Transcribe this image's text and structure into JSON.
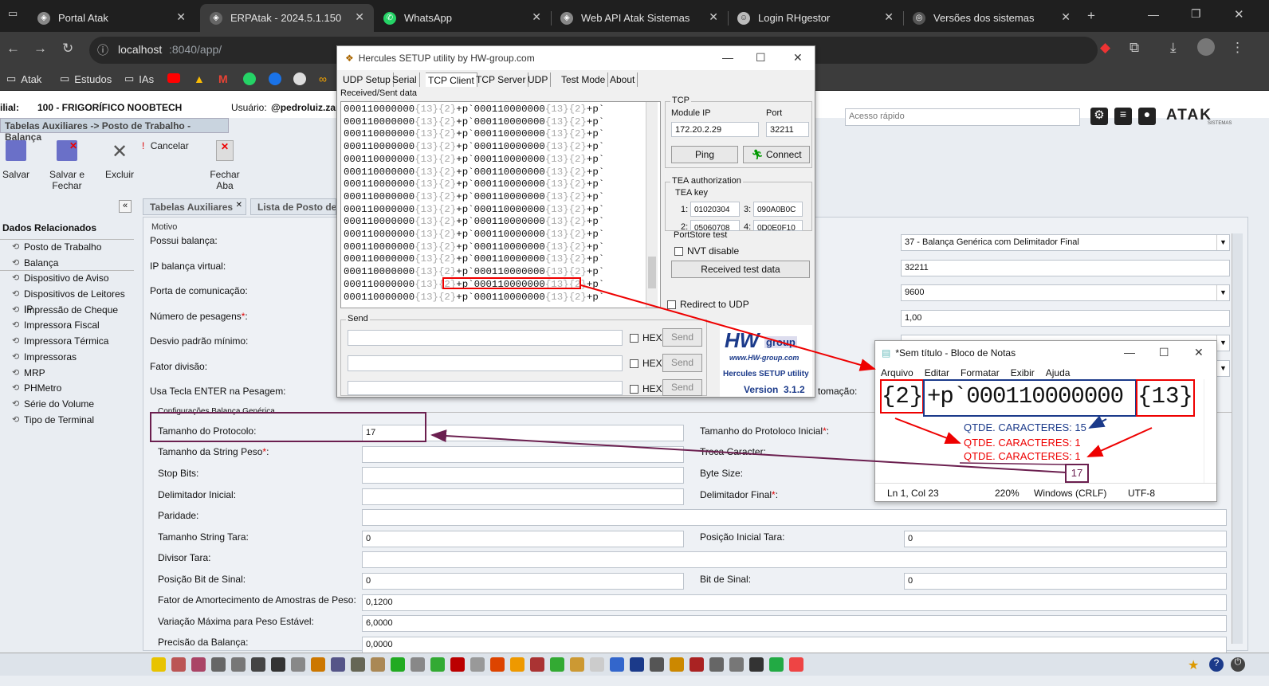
{
  "browser": {
    "tabs": [
      {
        "title": "Portal Atak"
      },
      {
        "title": "ERPAtak - 2024.5.1.150"
      },
      {
        "title": "WhatsApp"
      },
      {
        "title": "Web API Atak Sistemas"
      },
      {
        "title": "Login RHgestor"
      },
      {
        "title": "Versões dos sistemas"
      }
    ],
    "url_host": "localhost",
    "url_rest": ":8040/app/",
    "bookmarks": [
      "Atak",
      "Estudos",
      "IAs"
    ]
  },
  "erp": {
    "filial_label": "ilial:",
    "filial_value": "100 - FRIGORÍFICO NOOBTECH",
    "usuario_label": "Usuário:",
    "usuario_value": "@pedroluiz.zan",
    "quick_access_placeholder": "Acesso rápido",
    "logo": "ATAK",
    "logo_sub": "SISTEMAS",
    "breadcrumb": "Tabelas Auxiliares -> Posto de Trabalho - Balança",
    "toolbar": {
      "save": "Salvar",
      "save_close": "Salvar e Fechar",
      "delete": "Excluir",
      "cancel": "Cancelar",
      "close_tab": "Fechar Aba"
    },
    "tabs": [
      "Tabelas Auxiliares",
      "Lista de Posto de T"
    ],
    "sidebar": {
      "title": "Dados Relacionados",
      "items": [
        "Posto de Trabalho",
        "Balança",
        "Dispositivo de Aviso",
        "Dispositivos de Leitores IP",
        "Impressão de Cheque",
        "Impressora Fiscal",
        "Impressora Térmica",
        "Impressoras",
        "MRP",
        "PHMetro",
        "Série do Volume",
        "Tipo de Terminal"
      ]
    },
    "form": {
      "motivo_legend": "Motivo",
      "possui_balanca": "Possui balança:",
      "ip_balanca": "IP balança virtual:",
      "porta": "Porta de comunicação:",
      "num_pesagens": "Número de pesagens",
      "desvio": "Desvio padrão mínimo:",
      "fator_divisao": "Fator divisão:",
      "tecla_enter": "Usa Tecla ENTER na Pesagem:",
      "automacao_partial": "tomação:",
      "balanca_value": "37 - Balança Genérica com Delimitador Final",
      "ip_value": "32211",
      "porta_value": "9600",
      "num_value": "1,00",
      "config_legend": "Configurações Balança Genérica",
      "tam_protocolo": "Tamanho do Protocolo:",
      "tam_protocolo_value": "17",
      "tam_string_peso": "Tamanho da String Peso",
      "stop_bits": "Stop Bits:",
      "delim_inicial": "Delimitador Inicial:",
      "paridade": "Paridade:",
      "tam_string_tara": "Tamanho String Tara:",
      "tam_string_tara_value": "0",
      "divisor_tara": "Divisor Tara:",
      "pos_bit_sinal": "Posição Bit de Sinal:",
      "pos_bit_sinal_value": "0",
      "fator_amort": "Fator de Amortecimento de Amostras de Peso:",
      "fator_amort_value": "0,1200",
      "variacao": "Variação Máxima para Peso Estável:",
      "variacao_value": "6,0000",
      "precisao": "Precisão da Balança:",
      "precisao_value": "0,0000",
      "tam_prot_inicial": "Tamanho do Protoloco Inicial",
      "troca_caracter": "Troca Caracter:",
      "byte_size": "Byte Size:",
      "delim_final": "Delimitador Final",
      "pos_inicial_tara": "Posição Inicial Tara:",
      "pos_inicial_tara_value": "0",
      "bit_sinal": "Bit de Sinal:",
      "bit_sinal_value": "0"
    }
  },
  "hercules": {
    "title": "Hercules SETUP utility by HW-group.com",
    "tabs": [
      "UDP Setup",
      "Serial",
      "TCP Client",
      "TCP Server",
      "UDP",
      "Test Mode",
      "About"
    ],
    "received_label": "Received/Sent data",
    "line_a": "000110000000",
    "line_b": "{13}{2}",
    "line_c": "+p`",
    "tcp_label": "TCP",
    "module_ip_label": "Module IP",
    "module_ip": "172.20.2.29",
    "port_label": "Port",
    "port": "32211",
    "ping": "Ping",
    "connect": "Connect",
    "tea_label": "TEA authorization",
    "tea_key": "TEA key",
    "tea1": "01020304",
    "tea3": "090A0B0C",
    "tea2": "05060708",
    "tea4": "0D0E0F10",
    "portstore": "PortStore test",
    "nvt": "NVT disable",
    "received_test": "Received test data",
    "redirect": "Redirect to UDP",
    "send_label": "Send",
    "hex": "HEX",
    "send": "Send",
    "logo_hw": "HW",
    "logo_group": "group",
    "logo_url": "www.HW-group.com",
    "logo_product": "Hercules SETUP utility",
    "logo_version": "Version  3.1.2"
  },
  "notepad": {
    "title": "*Sem título - Bloco de Notas",
    "menu": [
      "Arquivo",
      "Editar",
      "Formatar",
      "Exibir",
      "Ajuda"
    ],
    "seg1": "{2}",
    "seg2": "+p`000110000000",
    "seg3": "{13}",
    "qtde15": "QTDE. CARACTERES: 15",
    "qtde1a": "QTDE. CARACTERES: 1",
    "qtde1b": "QTDE. CARACTERES: 1",
    "total": "17",
    "status": [
      "Ln 1, Col 23",
      "220%",
      "Windows (CRLF)",
      "UTF-8"
    ]
  }
}
